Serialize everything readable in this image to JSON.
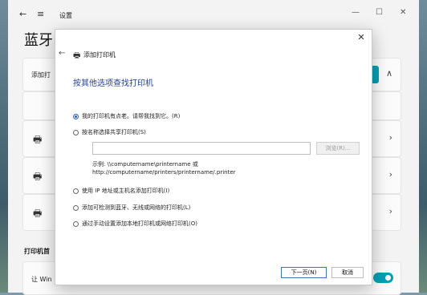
{
  "settings": {
    "back_glyph": "←",
    "menu_glyph": "≡",
    "title": "设置",
    "minimize_glyph": "—",
    "maximize_glyph": "☐",
    "close_glyph": "✕",
    "heading": "蓝牙",
    "add_printer_label": "添加打",
    "printer_prefs_title": "打印机首",
    "windows_manage_label": "让 Win",
    "chevron_up": "∧",
    "chevron_right": "›",
    "printer_glyph": "🖶"
  },
  "dialog": {
    "close_glyph": "✕",
    "back_glyph": "←",
    "printer_glyph": "🖶",
    "title": "添加打印机",
    "instruction": "按其他选项查找打印机",
    "options": [
      "我的打印机有点老。请帮我找到它。(R)",
      "按名称选择共享打印机(S)",
      "使用 IP 地址或主机名添加打印机(I)",
      "添加可检测到蓝牙、无线或网络的打印机(L)",
      "通过手动设置添加本地打印机或网络打印机(O)"
    ],
    "selected_option": 0,
    "share_name_value": "",
    "browse_label": "浏览(R)...",
    "example_line1": "示例: \\\\computername\\printername 或",
    "example_line2": "http://computername/printers/printername/.printer",
    "next_label": "下一页(N)",
    "cancel_label": "取消"
  },
  "colors": {
    "accent": "#00a2b5",
    "link_blue": "#1f3f9c"
  }
}
